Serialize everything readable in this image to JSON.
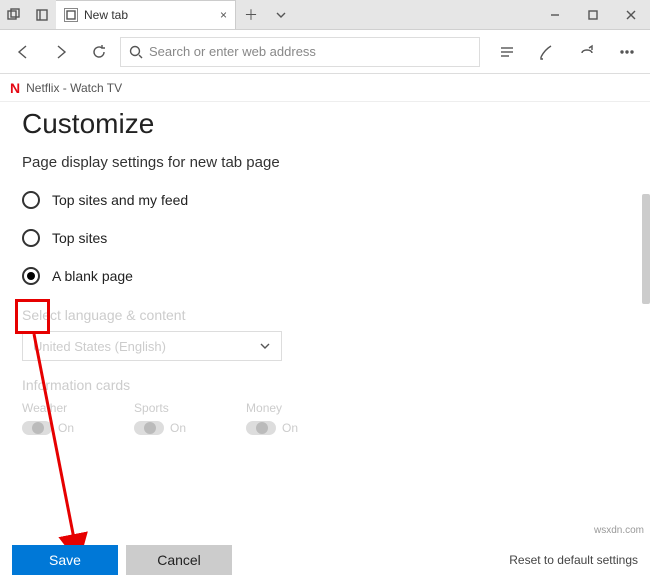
{
  "titlebar": {
    "tab_title": "New tab",
    "bookmark_label": "Netflix - Watch TV"
  },
  "addressbar": {
    "placeholder": "Search or enter web address"
  },
  "settings": {
    "heading": "Customize",
    "subheading": "Page display settings for new tab page",
    "options": {
      "top_sites_feed": "Top sites and my feed",
      "top_sites": "Top sites",
      "blank_page": "A blank page"
    },
    "lang_section": "Select language & content",
    "lang_value": "United States (English)",
    "cards_section": "Information cards",
    "cards": {
      "weather": "Weather",
      "sports": "Sports",
      "money": "Money"
    },
    "toggle_state": "On"
  },
  "actions": {
    "save": "Save",
    "cancel": "Cancel",
    "reset": "Reset to default settings"
  },
  "watermark": "wsxdn.com"
}
